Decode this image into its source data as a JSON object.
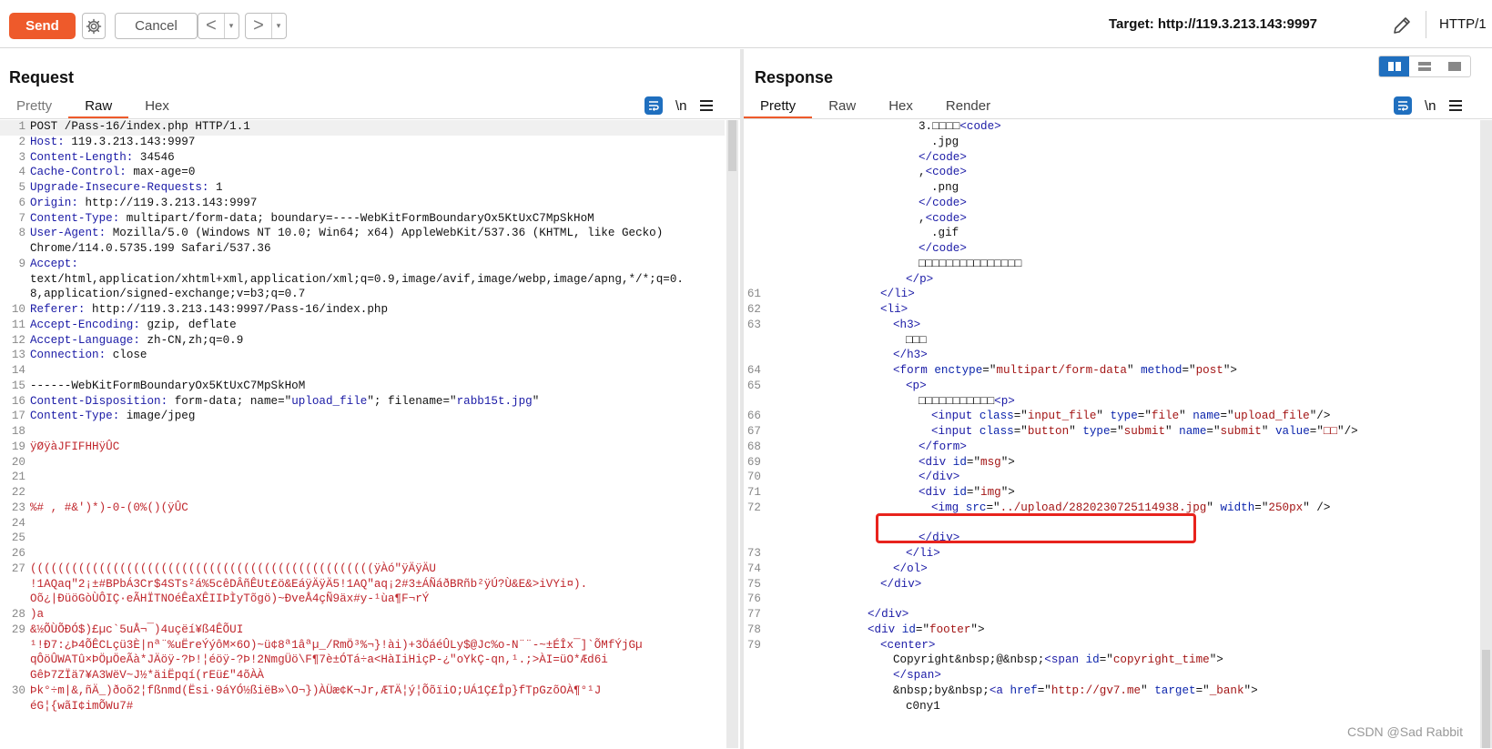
{
  "toolbar": {
    "send_label": "Send",
    "cancel_label": "Cancel",
    "back_icon": "<",
    "forward_icon": ">",
    "dropdown_icon": "▾",
    "target": "Target: http://119.3.213.143:9997",
    "protocol": "HTTP/1",
    "accent": "#ee5a2b"
  },
  "request": {
    "title": "Request",
    "tabs": [
      "Pretty",
      "Raw",
      "Hex"
    ],
    "active_tab": "Raw",
    "newline_icon": "\\n",
    "lines": [
      {
        "n": "1",
        "parts": [
          [
            "v",
            "POST /Pass-16/index.php HTTP/1.1"
          ]
        ]
      },
      {
        "n": "2",
        "parts": [
          [
            "k",
            "Host:"
          ],
          [
            "v",
            " 119.3.213.143:9997"
          ]
        ]
      },
      {
        "n": "3",
        "parts": [
          [
            "k",
            "Content-Length:"
          ],
          [
            "v",
            " 34546"
          ]
        ]
      },
      {
        "n": "4",
        "parts": [
          [
            "k",
            "Cache-Control:"
          ],
          [
            "v",
            " max-age=0"
          ]
        ]
      },
      {
        "n": "5",
        "parts": [
          [
            "k",
            "Upgrade-Insecure-Requests:"
          ],
          [
            "v",
            " 1"
          ]
        ]
      },
      {
        "n": "6",
        "parts": [
          [
            "k",
            "Origin:"
          ],
          [
            "v",
            " http://119.3.213.143:9997"
          ]
        ]
      },
      {
        "n": "7",
        "parts": [
          [
            "k",
            "Content-Type:"
          ],
          [
            "v",
            " multipart/form-data; boundary=----WebKitFormBoundaryOx5KtUxC7MpSkHoM"
          ]
        ]
      },
      {
        "n": "8",
        "parts": [
          [
            "k",
            "User-Agent:"
          ],
          [
            "v",
            " Mozilla/5.0 (Windows NT 10.0; Win64; x64) AppleWebKit/537.36 (KHTML, like Gecko)"
          ]
        ]
      },
      {
        "n": "",
        "parts": [
          [
            "v",
            "Chrome/114.0.5735.199 Safari/537.36"
          ]
        ]
      },
      {
        "n": "9",
        "parts": [
          [
            "k",
            "Accept:"
          ]
        ]
      },
      {
        "n": "",
        "parts": [
          [
            "v",
            "text/html,application/xhtml+xml,application/xml;q=0.9,image/avif,image/webp,image/apng,*/*;q=0."
          ]
        ]
      },
      {
        "n": "",
        "parts": [
          [
            "v",
            "8,application/signed-exchange;v=b3;q=0.7"
          ]
        ]
      },
      {
        "n": "10",
        "parts": [
          [
            "k",
            "Referer:"
          ],
          [
            "v",
            " http://119.3.213.143:9997/Pass-16/index.php"
          ]
        ]
      },
      {
        "n": "11",
        "parts": [
          [
            "k",
            "Accept-Encoding:"
          ],
          [
            "v",
            " gzip, deflate"
          ]
        ]
      },
      {
        "n": "12",
        "parts": [
          [
            "k",
            "Accept-Language:"
          ],
          [
            "v",
            " zh-CN,zh;q=0.9"
          ]
        ]
      },
      {
        "n": "13",
        "parts": [
          [
            "k",
            "Connection:"
          ],
          [
            "v",
            " close"
          ]
        ]
      },
      {
        "n": "14",
        "parts": []
      },
      {
        "n": "15",
        "parts": [
          [
            "v",
            "------WebKitFormBoundaryOx5KtUxC7MpSkHoM"
          ]
        ]
      },
      {
        "n": "16",
        "parts": [
          [
            "k",
            "Content-Disposition:"
          ],
          [
            "v",
            " form-data; name=\""
          ],
          [
            "k",
            "upload_file"
          ],
          [
            "v",
            "\"; filename=\""
          ],
          [
            "k",
            "rabb15t.jpg"
          ],
          [
            "v",
            "\""
          ]
        ]
      },
      {
        "n": "17",
        "parts": [
          [
            "k",
            "Content-Type:"
          ],
          [
            "v",
            " image/jpeg"
          ]
        ]
      },
      {
        "n": "18",
        "parts": []
      },
      {
        "n": "19",
        "parts": [
          [
            "bin",
            "ÿØÿàJFIFHHÿÛC"
          ]
        ]
      },
      {
        "n": "20",
        "parts": []
      },
      {
        "n": "21",
        "parts": []
      },
      {
        "n": "22",
        "parts": []
      },
      {
        "n": "23",
        "parts": [
          [
            "bin",
            "%# , #&')*)-0-(0%()(ÿÛC"
          ]
        ]
      },
      {
        "n": "24",
        "parts": []
      },
      {
        "n": "25",
        "parts": []
      },
      {
        "n": "26",
        "parts": []
      },
      {
        "n": "27",
        "parts": [
          [
            "bin",
            "((((((((((((((((((((((((((((((((((((((((((((((((((ÿÀó\"ÿÄÿÄU"
          ]
        ]
      },
      {
        "n": "",
        "parts": [
          [
            "bin",
            "!1AQaq\"2¡±#BPbÁ3Cr$4STs²á%5cêDÂñÊUt£ö&EáÿÄÿÄ5!1AQ\"aq¡2#3±ÁÑáðBRñb²ÿÚ?Ù&E&>iVYi¤)."
          ]
        ]
      },
      {
        "n": "",
        "parts": [
          [
            "bin",
            "Oõ¿|ÐüöGòÙÔIÇ·eÃHÏTNOéÊaXÊIIÞÌyTõgö)~ÐveÅ4çÑ9äx#y-¹ùa¶F¬rÝ"
          ]
        ]
      },
      {
        "n": "28",
        "parts": [
          [
            "bin",
            ")a"
          ]
        ]
      },
      {
        "n": "29",
        "parts": [
          [
            "bin",
            "&½ÕÙÕÐÓ$)£µc`5uÅ¬¯)4uçëí¥ß4ÊÕUI"
          ]
        ]
      },
      {
        "n": "",
        "parts": [
          [
            "bin",
            "¹!Ð7:¿Þ4ÕÊCLçü3È|nª¨%uËreÝýôM×6O)~ü¢8ª1âªµ_/RmÖ³%¬}!ài)+3ÖáéÛLy$@Jc%o-N¨¨-~±ÉÎx¯]`ÕMfÝjGµ"
          ]
        ]
      },
      {
        "n": "",
        "parts": [
          [
            "bin",
            "qÔöÛWATû×ÞÖµÖeÃà*JÄöÿ-?Þ!¦éöÿ-?Þ!2NmgÜö\\F¶7è±ÓTá÷a<HàIiHiçP-¿\"oYkÇ-qn,¹.;>ÀI=üO*Æd6i"
          ]
        ]
      },
      {
        "n": "",
        "parts": [
          [
            "bin",
            "GêÞ7ZÏä7¥A3WëV~J½*äiËpqí(rEü£\"4õÀÀ"
          ]
        ]
      },
      {
        "n": "30",
        "parts": [
          [
            "bin",
            "Þk°÷m|&,ñÄ_)ðoõ2¦fßnmd(Ësi·9áYÓ½ßiëB»\\O¬})ÀÜæ¢K¬Jr,ÆTÄ¦ý¦ÕõïiO;UÁ1Ç£Îp}fTpGzõOÀ¶°¹J"
          ]
        ]
      },
      {
        "n": "",
        "parts": [
          [
            "bin",
            "éG¦{wãI¢imÕWu7#"
          ]
        ]
      }
    ]
  },
  "response": {
    "title": "Response",
    "tabs": [
      "Pretty",
      "Raw",
      "Hex",
      "Render"
    ],
    "active_tab": "Pretty",
    "newline_icon": "\\n",
    "lines": [
      {
        "n": "",
        "i": 8,
        "parts": [
          [
            "tx",
            "3.□□□□"
          ],
          [
            "tg",
            "<code>"
          ]
        ]
      },
      {
        "n": "",
        "i": 9,
        "parts": [
          [
            "tx",
            ".jpg"
          ]
        ]
      },
      {
        "n": "",
        "i": 8,
        "parts": [
          [
            "tg",
            "</code>"
          ]
        ]
      },
      {
        "n": "",
        "i": 8,
        "parts": [
          [
            "tx",
            ","
          ],
          [
            "tg",
            "<code>"
          ]
        ]
      },
      {
        "n": "",
        "i": 9,
        "parts": [
          [
            "tx",
            ".png"
          ]
        ]
      },
      {
        "n": "",
        "i": 8,
        "parts": [
          [
            "tg",
            "</code>"
          ]
        ]
      },
      {
        "n": "",
        "i": 8,
        "parts": [
          [
            "tx",
            ","
          ],
          [
            "tg",
            "<code>"
          ]
        ]
      },
      {
        "n": "",
        "i": 9,
        "parts": [
          [
            "tx",
            ".gif"
          ]
        ]
      },
      {
        "n": "",
        "i": 8,
        "parts": [
          [
            "tg",
            "</code>"
          ]
        ]
      },
      {
        "n": "",
        "i": 8,
        "parts": [
          [
            "tx",
            "□□□□□□□□□□□□□□□"
          ]
        ]
      },
      {
        "n": "",
        "i": 7,
        "parts": [
          [
            "tg",
            "</p>"
          ]
        ]
      },
      {
        "n": "61",
        "i": 5,
        "parts": [
          [
            "tg",
            "</li>"
          ]
        ]
      },
      {
        "n": "62",
        "i": 5,
        "parts": [
          [
            "tg",
            "<li>"
          ]
        ]
      },
      {
        "n": "63",
        "i": 6,
        "parts": [
          [
            "tg",
            "<h3>"
          ]
        ]
      },
      {
        "n": "",
        "i": 7,
        "parts": [
          [
            "tx",
            "□□□"
          ]
        ]
      },
      {
        "n": "",
        "i": 6,
        "parts": [
          [
            "tg",
            "</h3>"
          ]
        ]
      },
      {
        "n": "64",
        "i": 6,
        "parts": [
          [
            "tg",
            "<form "
          ],
          [
            "nm",
            "enctype"
          ],
          [
            "tx",
            "=\""
          ],
          [
            "st",
            "multipart/form-data"
          ],
          [
            "tx",
            "\" "
          ],
          [
            "nm",
            "method"
          ],
          [
            "tx",
            "=\""
          ],
          [
            "st",
            "post"
          ],
          [
            "tx",
            "\">"
          ]
        ]
      },
      {
        "n": "65",
        "i": 7,
        "parts": [
          [
            "tg",
            "<p>"
          ]
        ]
      },
      {
        "n": "",
        "i": 8,
        "parts": [
          [
            "tx",
            "□□□□□□□□□□□"
          ],
          [
            "tg",
            "<p>"
          ]
        ]
      },
      {
        "n": "66",
        "i": 9,
        "parts": [
          [
            "tg",
            "<input "
          ],
          [
            "nm",
            "class"
          ],
          [
            "tx",
            "=\""
          ],
          [
            "st",
            "input_file"
          ],
          [
            "tx",
            "\" "
          ],
          [
            "nm",
            "type"
          ],
          [
            "tx",
            "=\""
          ],
          [
            "st",
            "file"
          ],
          [
            "tx",
            "\" "
          ],
          [
            "nm",
            "name"
          ],
          [
            "tx",
            "=\""
          ],
          [
            "st",
            "upload_file"
          ],
          [
            "tx",
            "\"/>"
          ]
        ]
      },
      {
        "n": "67",
        "i": 9,
        "parts": [
          [
            "tg",
            "<input "
          ],
          [
            "nm",
            "class"
          ],
          [
            "tx",
            "=\""
          ],
          [
            "st",
            "button"
          ],
          [
            "tx",
            "\" "
          ],
          [
            "nm",
            "type"
          ],
          [
            "tx",
            "=\""
          ],
          [
            "st",
            "submit"
          ],
          [
            "tx",
            "\" "
          ],
          [
            "nm",
            "name"
          ],
          [
            "tx",
            "=\""
          ],
          [
            "st",
            "submit"
          ],
          [
            "tx",
            "\" "
          ],
          [
            "nm",
            "value"
          ],
          [
            "tx",
            "=\""
          ],
          [
            "st",
            "□□"
          ],
          [
            "tx",
            "\"/>"
          ]
        ]
      },
      {
        "n": "68",
        "i": 8,
        "parts": [
          [
            "tg",
            "</form>"
          ]
        ]
      },
      {
        "n": "69",
        "i": 8,
        "parts": [
          [
            "tg",
            "<div "
          ],
          [
            "nm",
            "id"
          ],
          [
            "tx",
            "=\""
          ],
          [
            "st",
            "msg"
          ],
          [
            "tx",
            "\">"
          ]
        ]
      },
      {
        "n": "70",
        "i": 8,
        "parts": [
          [
            "tg",
            "</div>"
          ]
        ]
      },
      {
        "n": "71",
        "i": 8,
        "parts": [
          [
            "tg",
            "<div "
          ],
          [
            "nm",
            "id"
          ],
          [
            "tx",
            "=\""
          ],
          [
            "st",
            "img"
          ],
          [
            "tx",
            "\">"
          ]
        ]
      },
      {
        "n": "72",
        "i": 9,
        "parts": [
          [
            "tg",
            "<img "
          ],
          [
            "nm",
            "src"
          ],
          [
            "tx",
            "=\""
          ],
          [
            "st",
            "../upload/2820230725114938.jpg"
          ],
          [
            "tx",
            "\" "
          ],
          [
            "nm",
            "width"
          ],
          [
            "tx",
            "=\""
          ],
          [
            "st",
            "250px"
          ],
          [
            "tx",
            "\" />"
          ]
        ]
      },
      {
        "n": "",
        "i": 0,
        "parts": []
      },
      {
        "n": "",
        "i": 8,
        "parts": [
          [
            "tg",
            "</div>"
          ]
        ]
      },
      {
        "n": "73",
        "i": 7,
        "parts": [
          [
            "tg",
            "</li>"
          ]
        ]
      },
      {
        "n": "74",
        "i": 6,
        "parts": [
          [
            "tg",
            "</ol>"
          ]
        ]
      },
      {
        "n": "75",
        "i": 5,
        "parts": [
          [
            "tg",
            "</div>"
          ]
        ]
      },
      {
        "n": "76",
        "i": 0,
        "parts": []
      },
      {
        "n": "77",
        "i": 4,
        "parts": [
          [
            "tg",
            "</div>"
          ]
        ]
      },
      {
        "n": "78",
        "i": 4,
        "parts": [
          [
            "tg",
            "<div "
          ],
          [
            "nm",
            "id"
          ],
          [
            "tx",
            "=\""
          ],
          [
            "st",
            "footer"
          ],
          [
            "tx",
            "\">"
          ]
        ]
      },
      {
        "n": "79",
        "i": 5,
        "parts": [
          [
            "tg",
            "<center>"
          ]
        ]
      },
      {
        "n": "",
        "i": 6,
        "parts": [
          [
            "tx",
            "Copyright&nbsp;@&nbsp;"
          ],
          [
            "tg",
            "<span "
          ],
          [
            "nm",
            "id"
          ],
          [
            "tx",
            "=\""
          ],
          [
            "st",
            "copyright_time"
          ],
          [
            "tx",
            "\">"
          ]
        ]
      },
      {
        "n": "",
        "i": 6,
        "parts": [
          [
            "tg",
            "</span>"
          ]
        ]
      },
      {
        "n": "",
        "i": 6,
        "parts": [
          [
            "tx",
            "&nbsp;by&nbsp;"
          ],
          [
            "tg",
            "<a "
          ],
          [
            "nm",
            "href"
          ],
          [
            "tx",
            "=\""
          ],
          [
            "st",
            "http://gv7.me"
          ],
          [
            "tx",
            "\" "
          ],
          [
            "nm",
            "target"
          ],
          [
            "tx",
            "=\""
          ],
          [
            "st",
            "_bank"
          ],
          [
            "tx",
            "\">"
          ]
        ]
      },
      {
        "n": "",
        "i": 7,
        "parts": [
          [
            "tx",
            "c0ny1"
          ]
        ]
      }
    ]
  },
  "watermark": "CSDN @Sad Rabbit",
  "colors": {
    "accent": "#ee5a2b",
    "highlight_box": "#e8231d",
    "icon_blue": "#1f6fbf"
  }
}
